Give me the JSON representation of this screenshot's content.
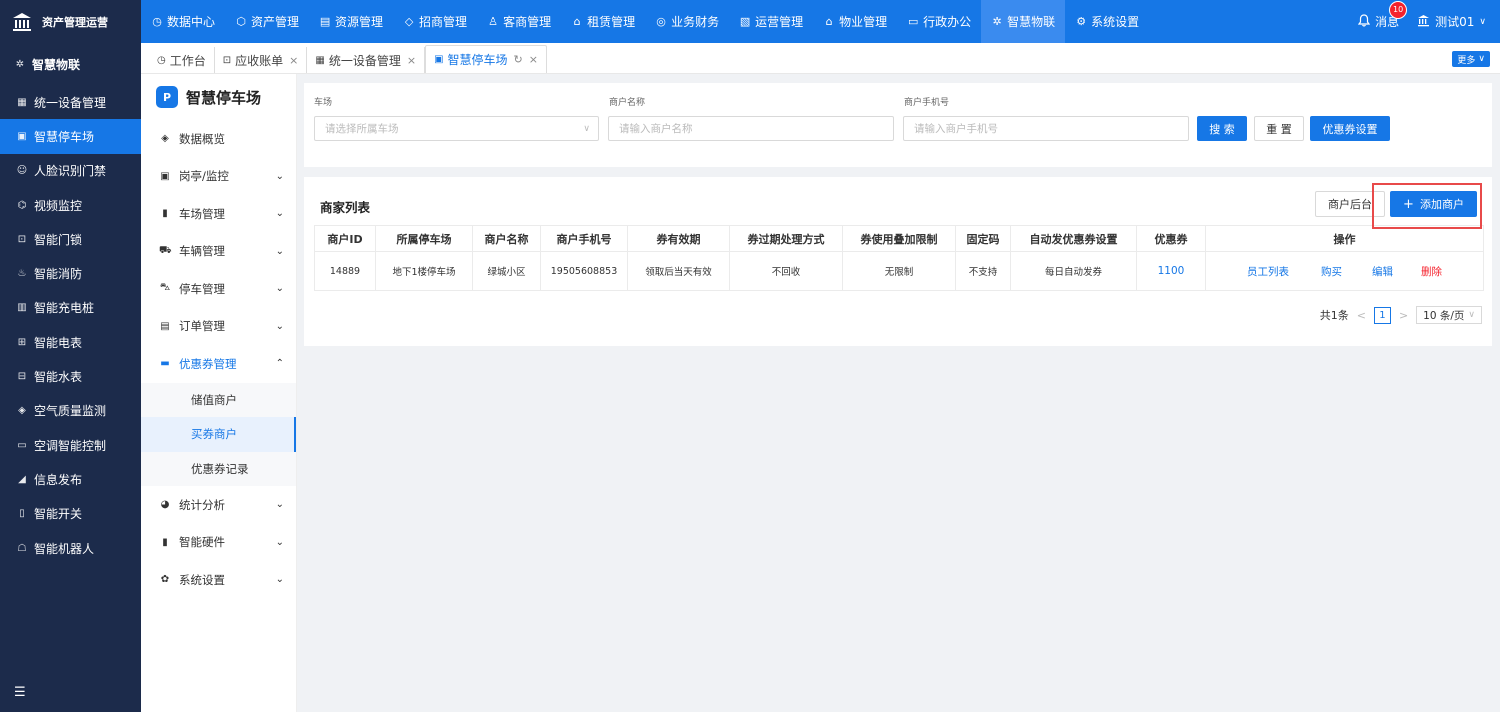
{
  "brand": {
    "title": "资产管理运营"
  },
  "topnav": [
    {
      "label": "数据中心",
      "icon": "◷"
    },
    {
      "label": "资产管理",
      "icon": "⬡"
    },
    {
      "label": "资源管理",
      "icon": "▤"
    },
    {
      "label": "招商管理",
      "icon": "◇"
    },
    {
      "label": "客商管理",
      "icon": "♙"
    },
    {
      "label": "租赁管理",
      "icon": "⌂"
    },
    {
      "label": "业务财务",
      "icon": "◎"
    },
    {
      "label": "运营管理",
      "icon": "▧"
    },
    {
      "label": "物业管理",
      "icon": "⌂"
    },
    {
      "label": "行政办公",
      "icon": "▭"
    },
    {
      "label": "智慧物联",
      "icon": "✲"
    },
    {
      "label": "系统设置",
      "icon": "⚙"
    }
  ],
  "topright": {
    "message_label": "消息",
    "message_count": "10",
    "user_label": "测试01"
  },
  "sidebar": {
    "head": "智慧物联",
    "items": [
      {
        "label": "统一设备管理",
        "icon": "▦"
      },
      {
        "label": "智慧停车场",
        "icon": "▣"
      },
      {
        "label": "人脸识别门禁",
        "icon": "☺"
      },
      {
        "label": "视频监控",
        "icon": "⌬"
      },
      {
        "label": "智能门锁",
        "icon": "⊡"
      },
      {
        "label": "智能消防",
        "icon": "♨"
      },
      {
        "label": "智能充电桩",
        "icon": "▥"
      },
      {
        "label": "智能电表",
        "icon": "⊞"
      },
      {
        "label": "智能水表",
        "icon": "⊟"
      },
      {
        "label": "空气质量监测",
        "icon": "◈"
      },
      {
        "label": "空调智能控制",
        "icon": "▭"
      },
      {
        "label": "信息发布",
        "icon": "◢"
      },
      {
        "label": "智能开关",
        "icon": "▯"
      },
      {
        "label": "智能机器人",
        "icon": "☖"
      }
    ]
  },
  "tabs": [
    {
      "label": "工作台",
      "icon": "◷"
    },
    {
      "label": "应收账单",
      "icon": "⊡"
    },
    {
      "label": "统一设备管理",
      "icon": "▦"
    },
    {
      "label": "智慧停车场",
      "icon": "▣"
    }
  ],
  "more_label": "更多",
  "subnav": {
    "title": "智慧停车场",
    "items": [
      {
        "label": "数据概览",
        "icon": "◈"
      },
      {
        "label": "岗亭/监控",
        "icon": "▣"
      },
      {
        "label": "车场管理",
        "icon": "▮"
      },
      {
        "label": "车辆管理",
        "icon": "⛟"
      },
      {
        "label": "停车管理",
        "icon": "⛍"
      },
      {
        "label": "订单管理",
        "icon": "▤"
      },
      {
        "label": "优惠券管理",
        "icon": "▬"
      }
    ],
    "children": [
      "储值商户",
      "买券商户",
      "优惠券记录"
    ],
    "items_after": [
      {
        "label": "统计分析",
        "icon": "◕"
      },
      {
        "label": "智能硬件",
        "icon": "▮"
      },
      {
        "label": "系统设置",
        "icon": "✿"
      }
    ]
  },
  "filter": {
    "lot_label": "车场",
    "lot_placeholder": "请选择所属车场",
    "name_label": "商户名称",
    "name_placeholder": "请输入商户名称",
    "phone_label": "商户手机号",
    "phone_placeholder": "请输入商户手机号",
    "search": "搜 索",
    "reset": "重 置",
    "coupon_settings": "优惠券设置"
  },
  "list": {
    "title": "商家列表",
    "backend_btn": "商户后台",
    "add_btn": "添加商户",
    "columns": [
      "商户ID",
      "所属停车场",
      "商户名称",
      "商户手机号",
      "券有效期",
      "券过期处理方式",
      "券使用叠加限制",
      "固定码",
      "自动发优惠券设置",
      "优惠券",
      "操作"
    ],
    "rows": [
      {
        "id": "14889",
        "lot": "地下1楼停车场",
        "name": "绿城小区",
        "phone": "19505608853",
        "validity": "领取后当天有效",
        "expire": "不回收",
        "stack": "无限制",
        "fixed": "不支持",
        "auto": "每日自动发券",
        "coupon": "1100"
      }
    ],
    "ops": [
      "员工列表",
      "购买",
      "编辑",
      "删除"
    ],
    "pager": {
      "total": "共1条",
      "page": "1",
      "size": "10 条/页"
    }
  }
}
